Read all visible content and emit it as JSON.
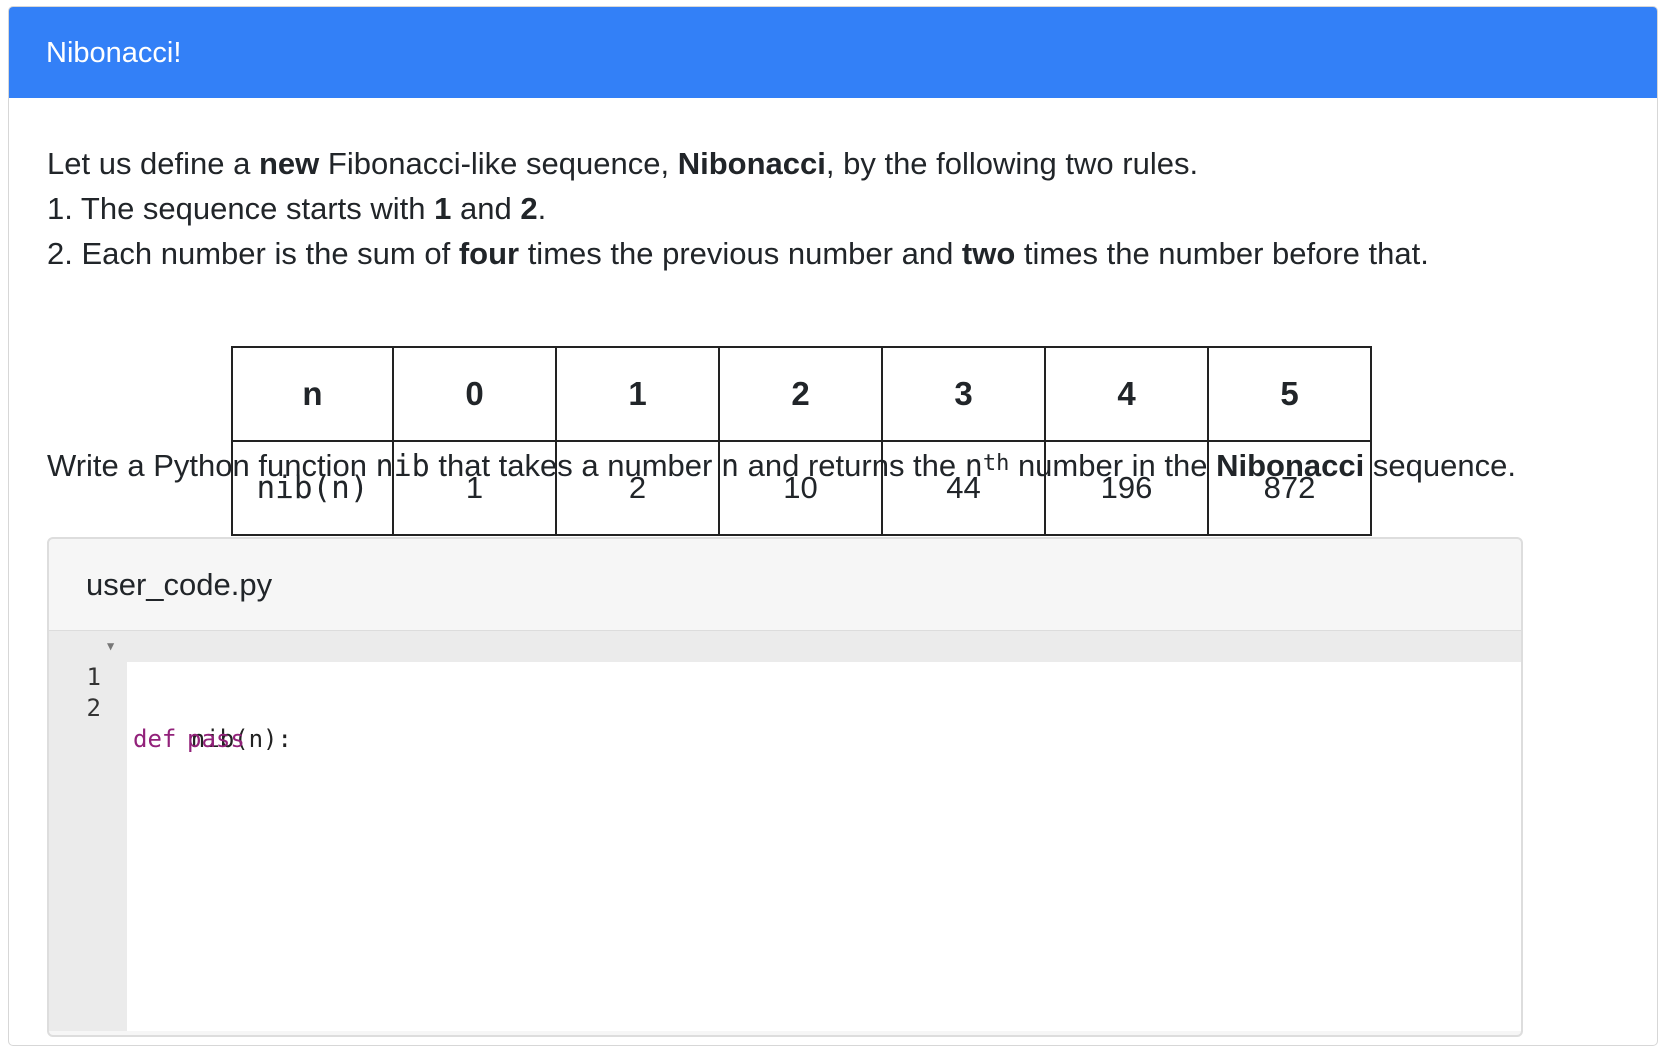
{
  "header": {
    "title": "Nibonacci!"
  },
  "intro": {
    "line1": {
      "t1": "Let us define a ",
      "b1": "new",
      "t2": " Fibonacci-like sequence, ",
      "b2": "Nibonacci",
      "t3": ", by the following two rules."
    },
    "line2": {
      "t1": "1. The sequence starts with ",
      "b1": "1",
      "t2": " and ",
      "b2": "2",
      "t3": "."
    },
    "line3": {
      "t1": "2. Each number is the sum of ",
      "b1": "four",
      "t2": " times the previous number and ",
      "b2": "two",
      "t3": " times the number before that."
    }
  },
  "table": {
    "header_label": "n",
    "row_label": "nib(n)",
    "n_values": [
      "0",
      "1",
      "2",
      "3",
      "4",
      "5"
    ],
    "nib_values": [
      "1",
      "2",
      "10",
      "44",
      "196",
      "872"
    ]
  },
  "task": {
    "t1": "Write a Python function ",
    "code1": "nib",
    "t2": " that takes a number ",
    "code2": "n",
    "t3": " and returns the ",
    "code3": "n",
    "sup": "th",
    "t4": " number in the ",
    "b1": "Nibonacci",
    "t5": " sequence."
  },
  "editor": {
    "filename": "user_code.py",
    "lines": [
      {
        "num": "1",
        "kw": "def",
        "rest": " nib(n):"
      },
      {
        "num": "2",
        "kw": "pass"
      }
    ]
  }
}
